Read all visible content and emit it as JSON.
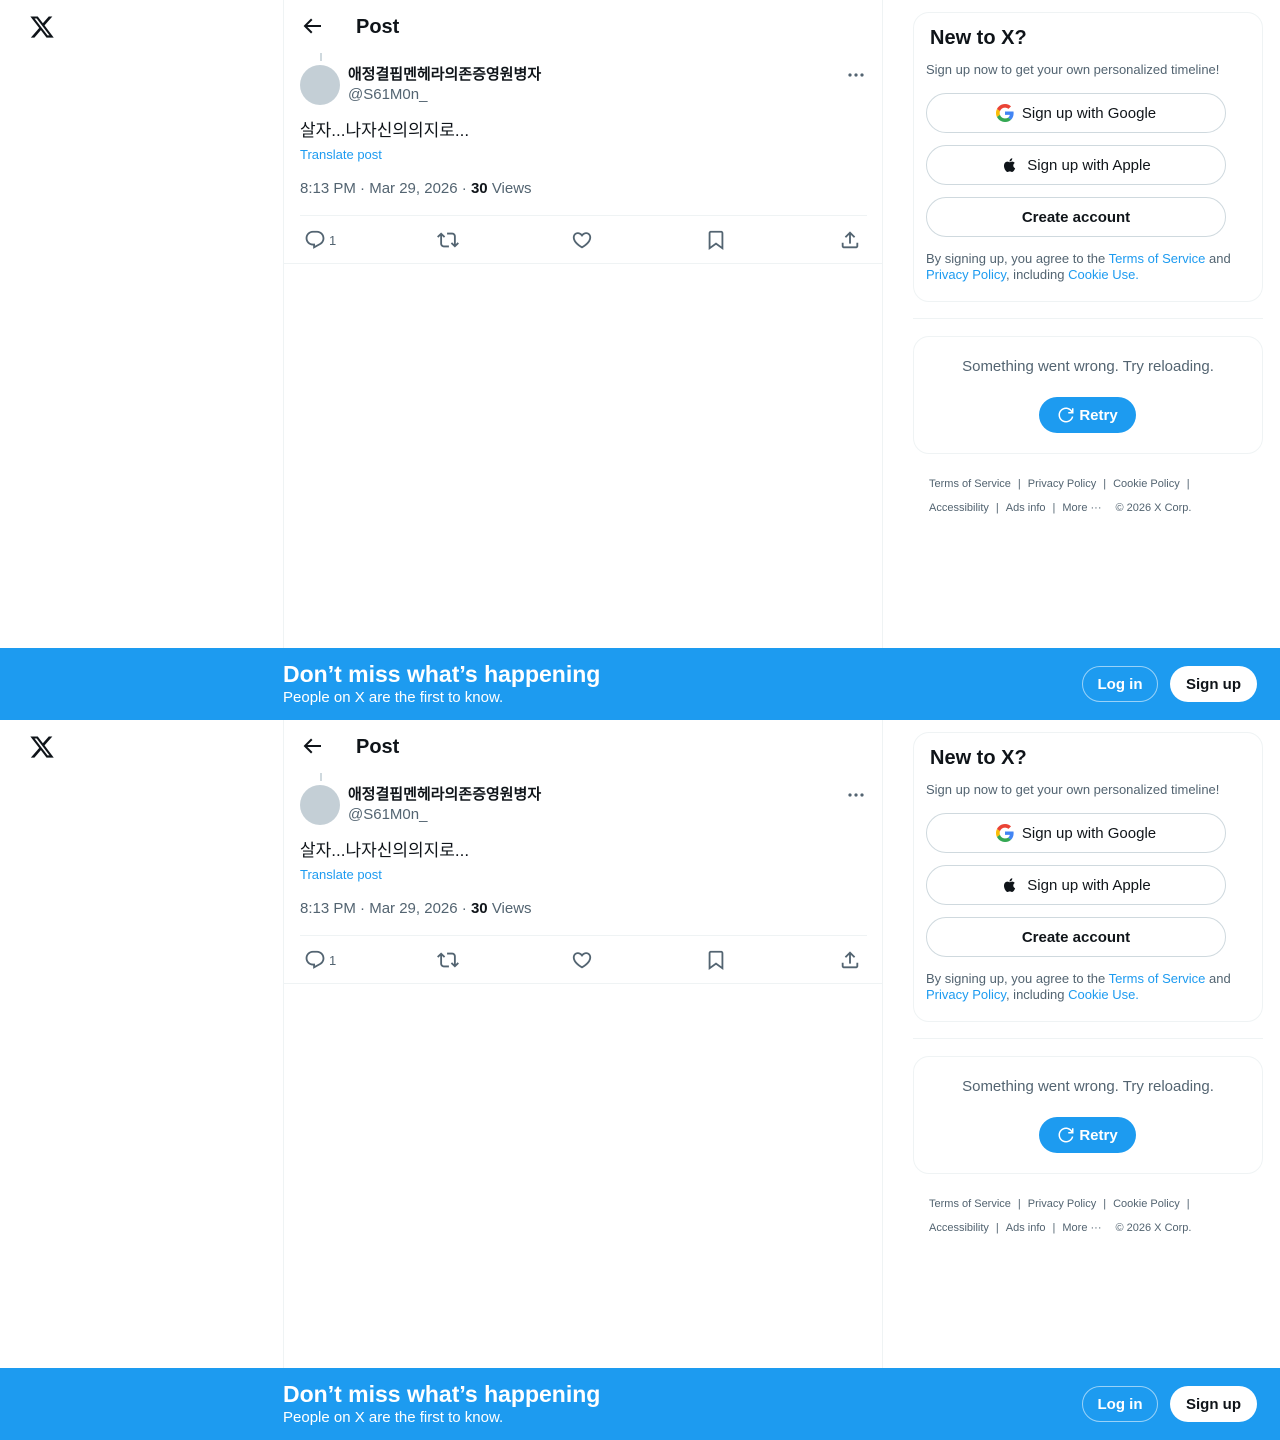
{
  "nav": {
    "logo": "X"
  },
  "header": {
    "title": "Post"
  },
  "post": {
    "author_name": "애정결핍멘헤라의존증영원병자",
    "author_handle": "@S61M0n_",
    "text": "살자...나자신의의지로...",
    "translate_label": "Translate post",
    "time": "8:13 PM",
    "date": "Mar 29, 2026",
    "views_count": "30",
    "views_label": "Views",
    "reply_count": "1"
  },
  "signup": {
    "title": "New to X?",
    "subtitle": "Sign up now to get your own personalized timeline!",
    "google_label": "Sign up with Google",
    "apple_label": "Sign up with Apple",
    "create_label": "Create account",
    "legal_prefix": "By signing up, you agree to the ",
    "terms": "Terms of Service",
    "and": " and ",
    "privacy": "Privacy Policy",
    "including": ", including ",
    "cookie": "Cookie Use."
  },
  "error": {
    "message": "Something went wrong. Try reloading.",
    "retry_label": "Retry"
  },
  "footer": {
    "terms": "Terms of Service",
    "privacy": "Privacy Policy",
    "cookie": "Cookie Policy",
    "accessibility": "Accessibility",
    "ads": "Ads info",
    "more": "More ···",
    "copyright": "© 2026 X Corp."
  },
  "banner": {
    "title": "Don’t miss what’s happening",
    "subtitle": "People on X are the first to know.",
    "login_label": "Log in",
    "signup_label": "Sign up"
  },
  "colors": {
    "accent": "#1d9bf0",
    "text_primary": "#0f1419",
    "text_secondary": "#536471",
    "border": "#eff3f4",
    "avatar_placeholder": "#c4cfd6"
  }
}
